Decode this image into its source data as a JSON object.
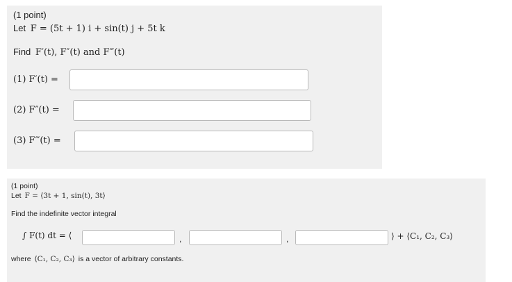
{
  "problem1": {
    "points": "(1 point)",
    "let_prefix": "Let",
    "F_def": "F = (5t + 1) i + sin(t) j + 5t k",
    "task_prefix": "Find",
    "task_terms": "F′(t), F″(t) and F‴(t)",
    "parts": [
      {
        "label": "(1) F′(t) =",
        "value": ""
      },
      {
        "label": "(2) F″(t) =",
        "value": ""
      },
      {
        "label": "(3) F‴(t) =",
        "value": ""
      }
    ]
  },
  "problem2": {
    "points": "(1 point)",
    "let_prefix": "Let",
    "F_def": "F = ⟨3t + 1, sin(t), 3t⟩",
    "task": "Find the indefinite vector integral",
    "integral_label": "∫ F(t) dt = ⟨",
    "separator": ",",
    "constant_suffix": "⟩ + ⟨C₁, C₂, C₃⟩",
    "components": [
      "",
      "",
      ""
    ],
    "where_prefix": "where",
    "where_math": "⟨C₁, C₂, C₃⟩",
    "where_suffix": "is a vector of arbitrary constants."
  }
}
